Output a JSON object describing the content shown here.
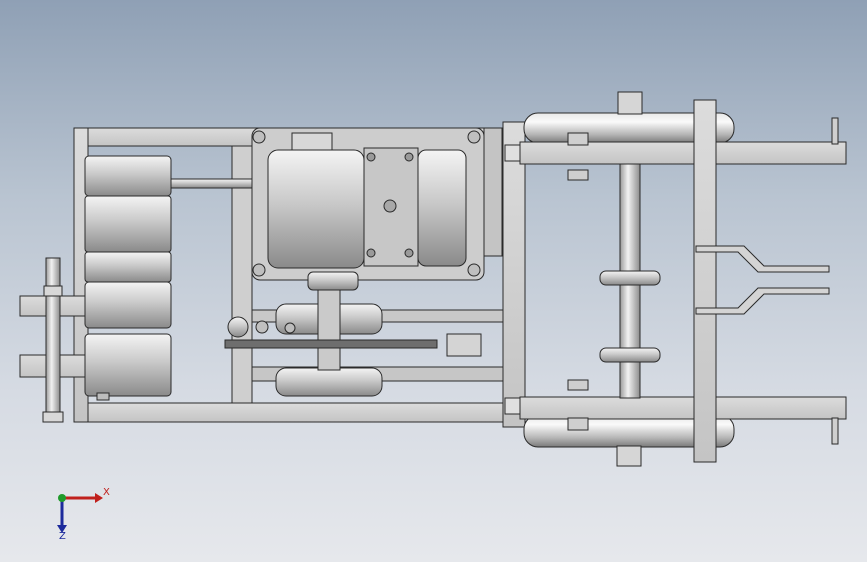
{
  "scene": {
    "background_top": "#8fa0b5",
    "background_bottom": "#e6e8ec",
    "part_color": "#d4d4d4",
    "edge_color": "#2a2a2a"
  },
  "triad": {
    "x_label": "X",
    "z_label": "Z",
    "x_color": "#c0201c",
    "y_color": "#1f9a2a",
    "z_color": "#1c2a9c"
  }
}
